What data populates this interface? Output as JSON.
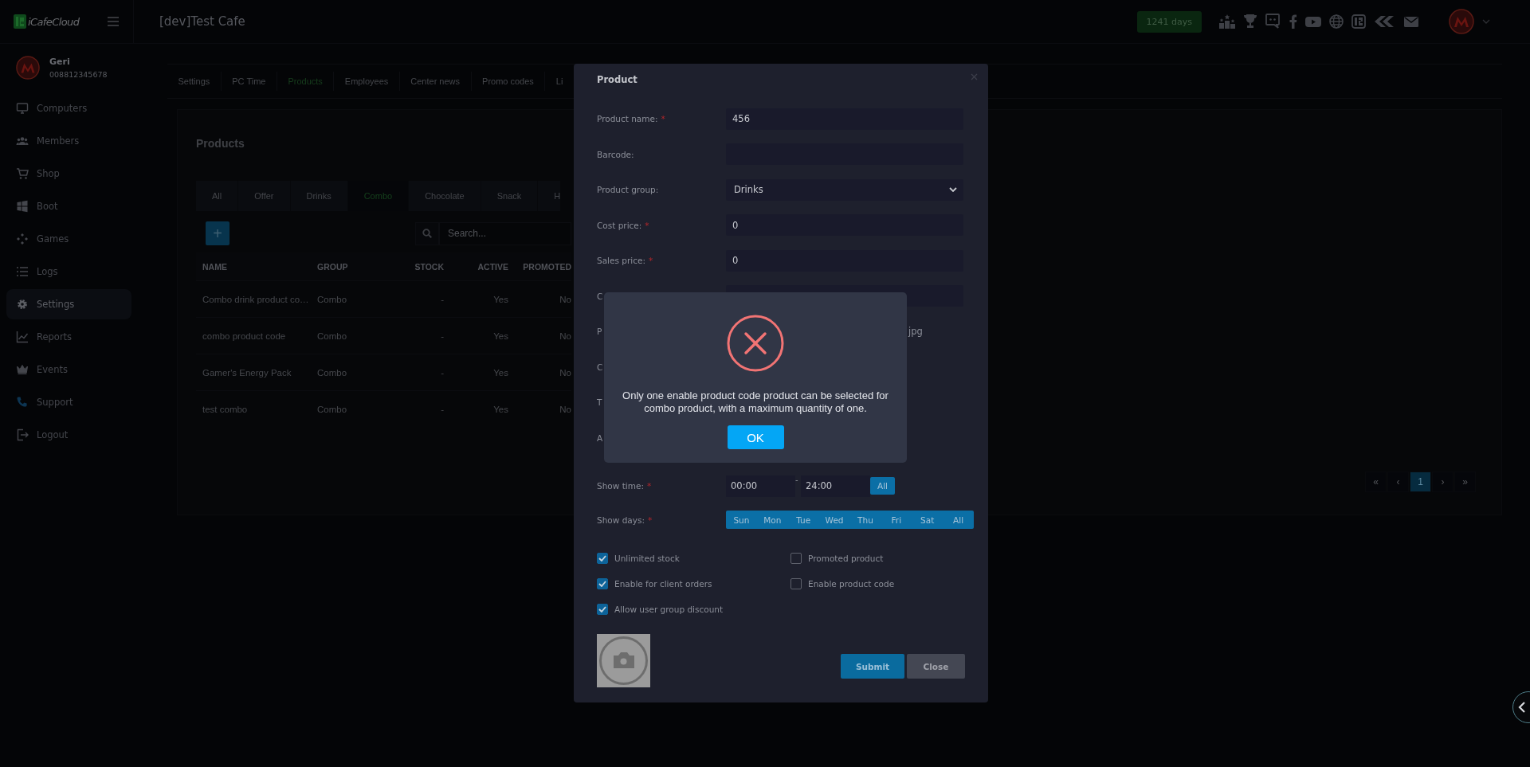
{
  "top_bar": {
    "logo_text": "iCafeCloud",
    "title": "[dev]Test Cafe",
    "days_badge": "1241 days"
  },
  "user": {
    "name": "Geri",
    "phone": "008812345678"
  },
  "sidebar": {
    "items": [
      {
        "label": "Computers",
        "selected": false
      },
      {
        "label": "Members",
        "selected": false
      },
      {
        "label": "Shop",
        "selected": false
      },
      {
        "label": "Boot",
        "selected": false
      },
      {
        "label": "Games",
        "selected": false
      },
      {
        "label": "Logs",
        "selected": false
      },
      {
        "label": "Settings",
        "selected": true
      },
      {
        "label": "Reports",
        "selected": false
      },
      {
        "label": "Events",
        "selected": false
      },
      {
        "label": "Support",
        "selected": false
      },
      {
        "label": "Logout",
        "selected": false
      }
    ]
  },
  "settings_tabs": [
    {
      "label": "Settings",
      "selected": false
    },
    {
      "label": "PC Time",
      "selected": false
    },
    {
      "label": "Products",
      "selected": true
    },
    {
      "label": "Employees",
      "selected": false
    },
    {
      "label": "Center news",
      "selected": false
    },
    {
      "label": "Promo codes",
      "selected": false
    },
    {
      "label": "Li",
      "selected": false
    }
  ],
  "products": {
    "title": "Products",
    "categories": [
      {
        "label": "All",
        "selected": false
      },
      {
        "label": "Offer",
        "selected": false
      },
      {
        "label": "Drinks",
        "selected": false
      },
      {
        "label": "Combo",
        "selected": true
      },
      {
        "label": "Chocolate",
        "selected": false
      },
      {
        "label": "Snack",
        "selected": false
      },
      {
        "label": "H",
        "selected": false
      }
    ],
    "add_button": "+",
    "search": {
      "placeholder": "Search..."
    },
    "table": {
      "columns": [
        "NAME",
        "GROUP",
        "STOCK",
        "ACTIVE",
        "PROMOTED"
      ],
      "rows": [
        [
          "Combo drink product co…",
          "Combo",
          "-",
          "Yes",
          "No"
        ],
        [
          "combo product code",
          "Combo",
          "-",
          "Yes",
          "No"
        ],
        [
          "Gamer's Energy Pack",
          "Combo",
          "-",
          "Yes",
          "No"
        ],
        [
          "test combo",
          "Combo",
          "-",
          "Yes",
          "No"
        ]
      ]
    },
    "pagination": [
      {
        "label": "«",
        "selected": false
      },
      {
        "label": "‹",
        "selected": false
      },
      {
        "label": "1",
        "selected": true
      },
      {
        "label": "›",
        "selected": false
      },
      {
        "label": "»",
        "selected": false
      }
    ]
  },
  "product_dialog": {
    "title": "Product",
    "fields": [
      {
        "kind": "text",
        "label": "Product name:",
        "required_mark": "*",
        "value": "456"
      },
      {
        "kind": "text",
        "label": "Barcode:"
      },
      {
        "kind": "select",
        "label": "Product group:",
        "value": "Drinks"
      },
      {
        "kind": "text",
        "label": "Cost price:",
        "required_mark": "*",
        "value": "0"
      },
      {
        "kind": "text",
        "label": "Sales price:",
        "required_mark": "*",
        "value": "0"
      },
      {
        "kind": "text",
        "label": "C"
      },
      {
        "kind": "note",
        "label": "P",
        "note": "jpg"
      },
      {
        "kind": "blank",
        "label": "C"
      },
      {
        "kind": "blank",
        "label": "T"
      },
      {
        "kind": "blank",
        "label": "A"
      },
      {
        "kind": "time",
        "label": "Show time:",
        "required_mark": "*",
        "from": "00:00",
        "separator": "-",
        "to": "24:00",
        "all_button": {
          "label": "All",
          "selected": true
        }
      },
      {
        "kind": "days",
        "label": "Show days:",
        "required_mark": "*",
        "days": [
          {
            "label": "Sun",
            "selected": true
          },
          {
            "label": "Mon",
            "selected": true
          },
          {
            "label": "Tue",
            "selected": true
          },
          {
            "label": "Wed",
            "selected": true
          },
          {
            "label": "Thu",
            "selected": true
          },
          {
            "label": "Fri",
            "selected": true
          },
          {
            "label": "Sat",
            "selected": true
          },
          {
            "label": "All",
            "selected": true
          }
        ]
      }
    ],
    "options": [
      {
        "label": "Unlimited stock",
        "checked": true
      },
      {
        "label": "Promoted product",
        "checked": false
      },
      {
        "label": "Enable for client orders",
        "checked": true
      },
      {
        "label": "Enable product code",
        "checked": false
      },
      {
        "label": "Allow user group discount",
        "checked": true
      }
    ],
    "buttons": [
      {
        "label": "Submit",
        "kind": "primary"
      },
      {
        "label": "Close",
        "kind": "secondary"
      }
    ]
  },
  "alert": {
    "message": "Only one enable product code product can be selected for combo product, with a maximum quantity of one.",
    "button": "OK"
  }
}
